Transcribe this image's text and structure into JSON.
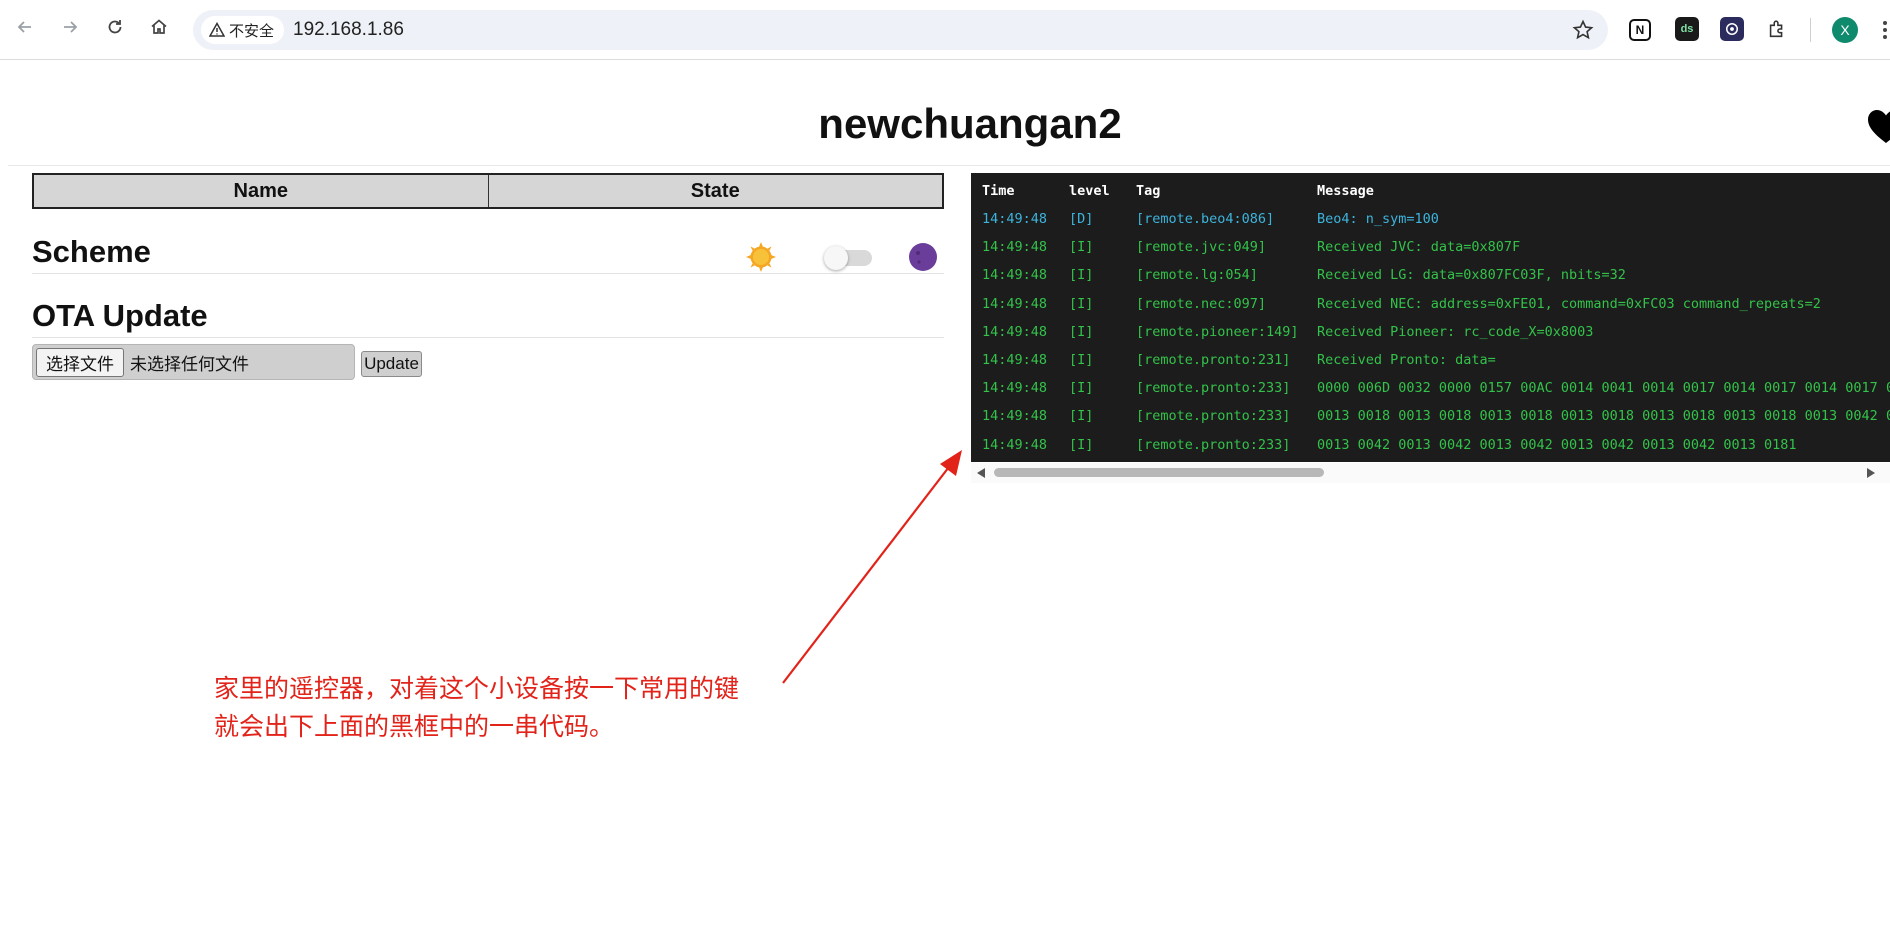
{
  "browser": {
    "security_label": "不安全",
    "url": "192.168.1.86",
    "profile_initial": "X",
    "extensions": [
      "notion-icon",
      "ds-icon",
      "obs-icon",
      "puzzle-icon"
    ]
  },
  "page": {
    "title": "newchuangan2"
  },
  "state_table": {
    "columns": [
      "Name",
      "State"
    ]
  },
  "scheme": {
    "heading": "Scheme",
    "toggle_on": false
  },
  "ota": {
    "heading": "OTA Update",
    "choose_file_label": "选择文件",
    "no_file_label": "未选择任何文件",
    "update_label": "Update"
  },
  "log": {
    "headers": {
      "time": "Time",
      "level": "level",
      "tag": "Tag",
      "message": "Message"
    },
    "rows": [
      {
        "time": "14:49:48",
        "level": "[D]",
        "tag": "[remote.beo4:086]",
        "message": "Beo4: n_sym=100"
      },
      {
        "time": "14:49:48",
        "level": "[I]",
        "tag": "[remote.jvc:049]",
        "message": "Received JVC: data=0x807F"
      },
      {
        "time": "14:49:48",
        "level": "[I]",
        "tag": "[remote.lg:054]",
        "message": "Received LG: data=0x807FC03F, nbits=32"
      },
      {
        "time": "14:49:48",
        "level": "[I]",
        "tag": "[remote.nec:097]",
        "message": "Received NEC: address=0xFE01, command=0xFC03 command_repeats=2"
      },
      {
        "time": "14:49:48",
        "level": "[I]",
        "tag": "[remote.pioneer:149]",
        "message": "Received Pioneer: rc_code_X=0x8003"
      },
      {
        "time": "14:49:48",
        "level": "[I]",
        "tag": "[remote.pronto:231]",
        "message": "Received Pronto: data="
      },
      {
        "time": "14:49:48",
        "level": "[I]",
        "tag": "[remote.pronto:233]",
        "message": "0000 006D 0032 0000 0157 00AC 0014 0041 0014 0017 0014 0017 0014 0017 0"
      },
      {
        "time": "14:49:48",
        "level": "[I]",
        "tag": "[remote.pronto:233]",
        "message": "0013 0018 0013 0018 0013 0018 0013 0018 0013 0018 0013 0018 0013 0042 0"
      },
      {
        "time": "14:49:48",
        "level": "[I]",
        "tag": "[remote.pronto:233]",
        "message": "0013 0042 0013 0042 0013 0042 0013 0042 0013 0042 0013 0181"
      }
    ]
  },
  "annotation": {
    "line1": "家里的遥控器，对着这个小设备按一下常用的键",
    "line2": "就会出下上面的黑框中的一串代码。",
    "color": "#e2231a"
  }
}
